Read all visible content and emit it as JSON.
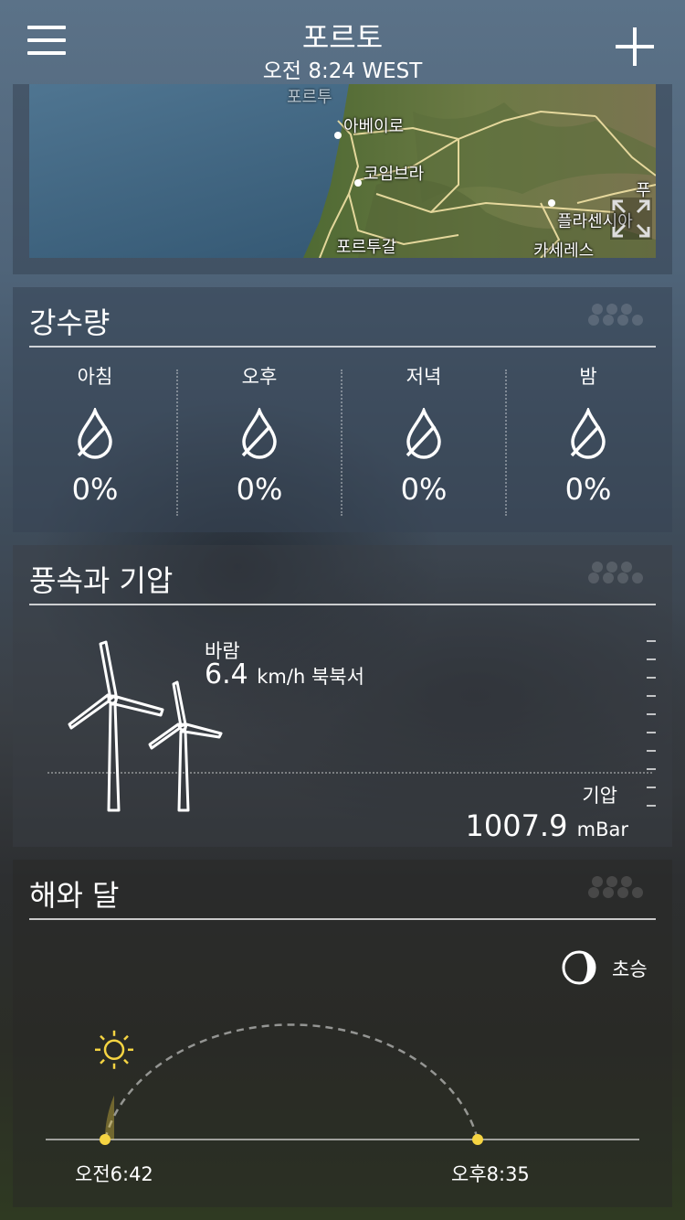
{
  "header": {
    "city": "포르토",
    "time": "오전 8:24 WEST"
  },
  "map": {
    "labels": [
      "포르투",
      "아베이로",
      "코임브라",
      "포르투갈",
      "플라센시아",
      "카세레스",
      "푸"
    ]
  },
  "precipitation": {
    "title": "강수량",
    "periods": [
      {
        "label": "아침",
        "value": "0%"
      },
      {
        "label": "오후",
        "value": "0%"
      },
      {
        "label": "저녁",
        "value": "0%"
      },
      {
        "label": "밤",
        "value": "0%"
      }
    ]
  },
  "wind_pressure": {
    "title": "풍속과 기압",
    "wind_label": "바람",
    "wind_speed": "6.4",
    "wind_unit": "km/h 북북서",
    "pressure_label": "기압",
    "pressure_value": "1007.9",
    "pressure_unit": "mBar"
  },
  "sun_moon": {
    "title": "해와 달",
    "moon_phase": "초승",
    "sunrise": "오전6:42",
    "sunset": "오후8:35",
    "daylight_elapsed_fraction": 0.1
  },
  "colors": {
    "sun": "#f5d442",
    "accent": "#ffffff"
  },
  "icons": [
    "menu-icon",
    "add-icon",
    "expand-icon",
    "raindrop-icon",
    "wind-turbine-icon",
    "moon-icon",
    "sun-icon"
  ]
}
